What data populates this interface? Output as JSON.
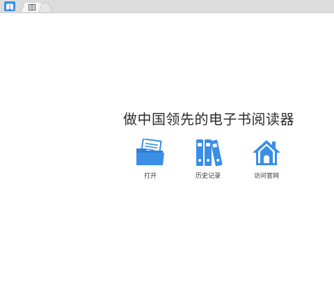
{
  "tabbar": {
    "app_icon": "book-open-icon",
    "active_tab_icon": "book-icon"
  },
  "main": {
    "headline": "做中国领先的电子书阅读器",
    "actions": [
      {
        "icon": "folder-open-icon",
        "label": "打开"
      },
      {
        "icon": "binders-icon",
        "label": "历史记录"
      },
      {
        "icon": "home-icon",
        "label": "访问官网"
      }
    ]
  },
  "colors": {
    "accent": "#3a8ee6",
    "tabbar_bg": "#dcdcdc",
    "text": "#2b2b2b"
  }
}
